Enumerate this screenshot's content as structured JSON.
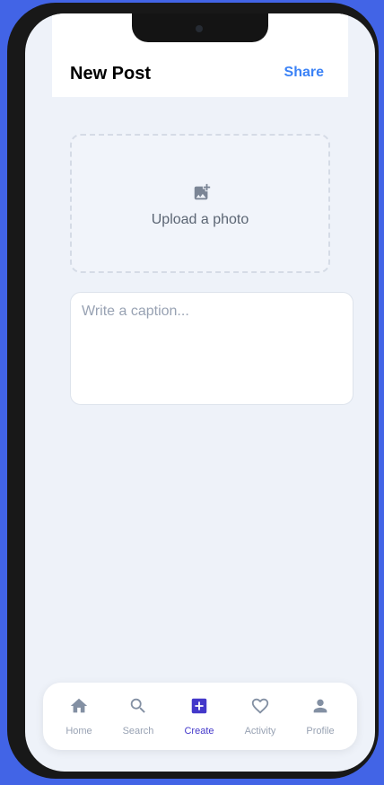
{
  "header": {
    "title": "New Post",
    "share_label": "Share"
  },
  "upload": {
    "label": "Upload a photo",
    "icon": "add-photo-icon"
  },
  "caption": {
    "placeholder": "Write a caption...",
    "value": ""
  },
  "tabbar": {
    "items": [
      {
        "label": "Home",
        "icon": "home-icon"
      },
      {
        "label": "Search",
        "icon": "search-icon"
      },
      {
        "label": "Create",
        "icon": "add-box-icon",
        "active": true
      },
      {
        "label": "Activity",
        "icon": "heart-icon"
      },
      {
        "label": "Profile",
        "icon": "person-icon"
      }
    ]
  },
  "colors": {
    "accent": "#3b82f6",
    "active_tab": "#4338ca",
    "inactive": "#98a2b3",
    "background": "#eef2f9"
  }
}
